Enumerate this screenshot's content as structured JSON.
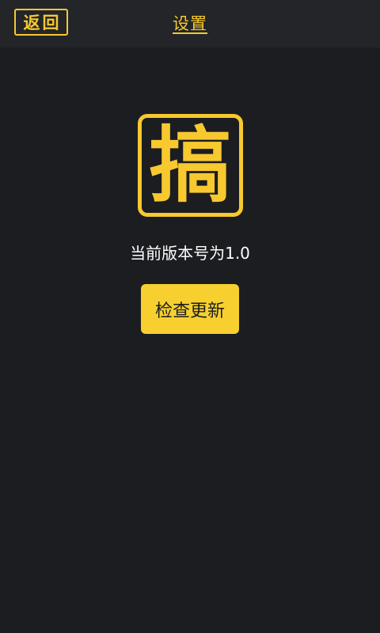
{
  "header": {
    "back_label": "返回",
    "title": "设置"
  },
  "logo": {
    "glyph": "搞"
  },
  "about": {
    "version_text": "当前版本号为1.0",
    "check_update_label": "检查更新"
  },
  "colors": {
    "accent": "#f7c92f",
    "button_bg": "#f7d02f",
    "background": "#1c1d21",
    "header_bg": "#232529"
  }
}
